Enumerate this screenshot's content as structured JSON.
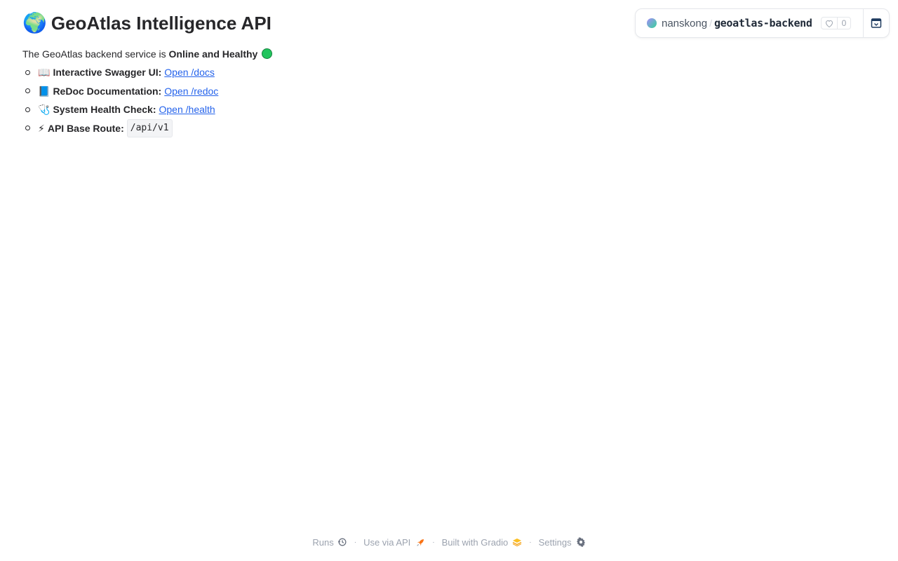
{
  "header": {
    "title_emoji": "🌍",
    "title": "GeoAtlas Intelligence API"
  },
  "intro": {
    "prefix": "The GeoAtlas backend service is",
    "status": "Online and Healthy",
    "status_color": "#22c55e"
  },
  "links": [
    {
      "emoji": "📖",
      "label": "Interactive Swagger UI:",
      "link_text": "Open /docs"
    },
    {
      "emoji": "📘",
      "label": "ReDoc Documentation:",
      "link_text": "Open /redoc"
    },
    {
      "emoji": "🩺",
      "label": "System Health Check:",
      "link_text": "Open /health"
    },
    {
      "emoji": "⚡",
      "label": "API Base Route:",
      "code": "/api/v1"
    }
  ],
  "space": {
    "owner": "nanskong",
    "repo": "geoatlas-backend",
    "likes": "0"
  },
  "footer": {
    "runs": "Runs",
    "api": "Use via API",
    "built": "Built with Gradio",
    "settings": "Settings"
  },
  "colors": {
    "link": "#2563eb",
    "accent_orange": "#f97316"
  }
}
